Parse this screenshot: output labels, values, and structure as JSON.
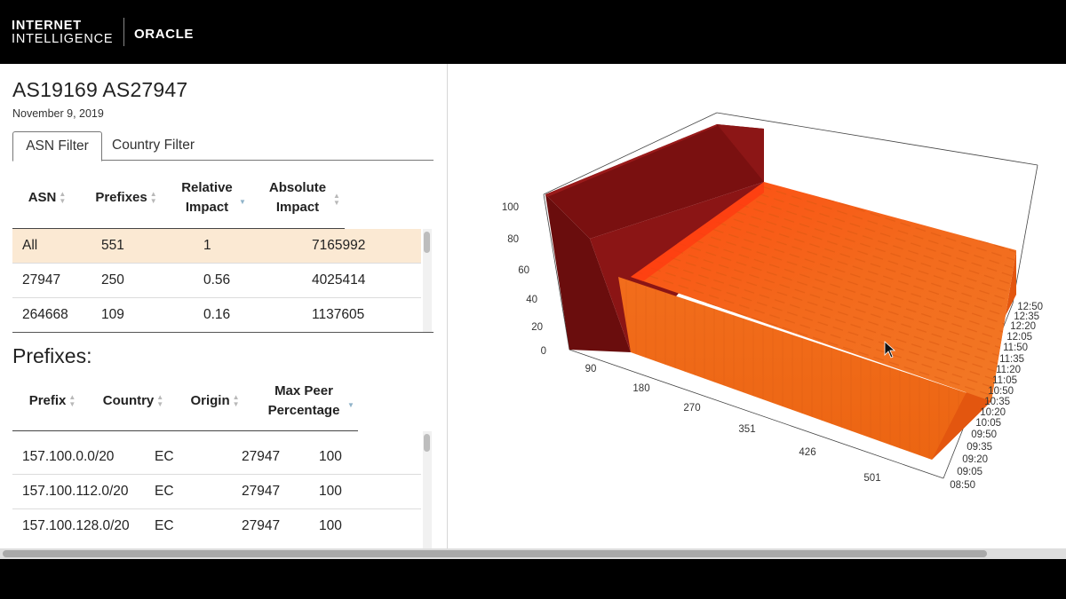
{
  "header": {
    "brand_line1": "INTERNET",
    "brand_line2": "INTELLIGENCE",
    "oracle": "ORACLE"
  },
  "page": {
    "title": "AS19169 AS27947",
    "date": "November 9, 2019"
  },
  "tabs": [
    {
      "label": "ASN Filter",
      "active": true
    },
    {
      "label": "Country Filter",
      "active": false
    }
  ],
  "asn_table": {
    "headers": {
      "asn": "ASN",
      "prefixes": "Prefixes",
      "relative_1": "Relative",
      "relative_2": "Impact",
      "absolute_1": "Absolute",
      "absolute_2": "Impact"
    },
    "rows": [
      {
        "asn": "All",
        "prefixes": "551",
        "relative": "1",
        "absolute": "7165992",
        "highlighted": true
      },
      {
        "asn": "27947",
        "prefixes": "250",
        "relative": "0.56",
        "absolute": "4025414",
        "highlighted": false
      },
      {
        "asn": "264668",
        "prefixes": "109",
        "relative": "0.16",
        "absolute": "1137605",
        "highlighted": false
      }
    ]
  },
  "prefixes": {
    "title": "Prefixes:",
    "headers": {
      "prefix": "Prefix",
      "country": "Country",
      "origin": "Origin",
      "maxpeer_1": "Max Peer",
      "maxpeer_2": "Percentage"
    },
    "rows": [
      {
        "prefix": "157.100.0.0/20",
        "country": "EC",
        "origin": "27947",
        "max_peer": "100"
      },
      {
        "prefix": "157.100.112.0/20",
        "country": "EC",
        "origin": "27947",
        "max_peer": "100"
      },
      {
        "prefix": "157.100.128.0/20",
        "country": "EC",
        "origin": "27947",
        "max_peer": "100"
      }
    ]
  },
  "chart_data": {
    "type": "surface3d",
    "z_ticks": [
      "100",
      "80",
      "60",
      "40",
      "20",
      "0"
    ],
    "x_ticks": [
      "90",
      "180",
      "270",
      "351",
      "426",
      "501"
    ],
    "y_ticks": [
      "12:50",
      "12:35",
      "12:20",
      "12:05",
      "11:50",
      "11:35",
      "11:20",
      "11:05",
      "10:50",
      "10:35",
      "10:20",
      "10:05",
      "09:50",
      "09:35",
      "09:20",
      "09:05",
      "08:50"
    ],
    "colors": {
      "high_block": "#8a1414",
      "surface_top": "#f26a1b",
      "surface_front": "#ef6a17",
      "surface_right": "#e5560f"
    }
  }
}
